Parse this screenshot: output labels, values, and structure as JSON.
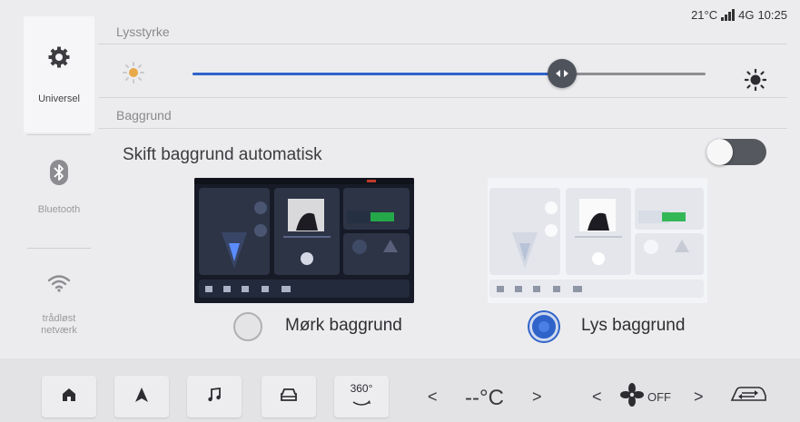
{
  "status": {
    "temperature": "21°C",
    "network": "4G",
    "time": "10:25"
  },
  "sidebar": {
    "items": [
      {
        "label": "Universel",
        "icon": "gear-icon",
        "active": true
      },
      {
        "label": "Bluetooth",
        "icon": "bluetooth-icon",
        "active": false
      },
      {
        "label": "trådløst netværk",
        "icon": "wifi-icon",
        "active": false
      }
    ]
  },
  "brightness": {
    "title": "Lysstyrke",
    "level_percent": 72
  },
  "wallpaper": {
    "title": "Baggrund",
    "auto_label": "Skift baggrund automatisk",
    "auto_enabled": false,
    "options": [
      {
        "label": "Mørk baggrund",
        "selected": false
      },
      {
        "label": "Lys baggrund",
        "selected": true
      }
    ]
  },
  "bottombar": {
    "home_icon": "home-icon",
    "nav_icon": "navigation-icon",
    "music_icon": "music-icon",
    "car_icon": "car-icon",
    "view360_label": "360°",
    "temperature_value": "--°C",
    "fan_label": "OFF",
    "chevron_left": "<",
    "chevron_right": ">"
  },
  "colors": {
    "accent": "#2f63c9",
    "background": "#ececee"
  }
}
